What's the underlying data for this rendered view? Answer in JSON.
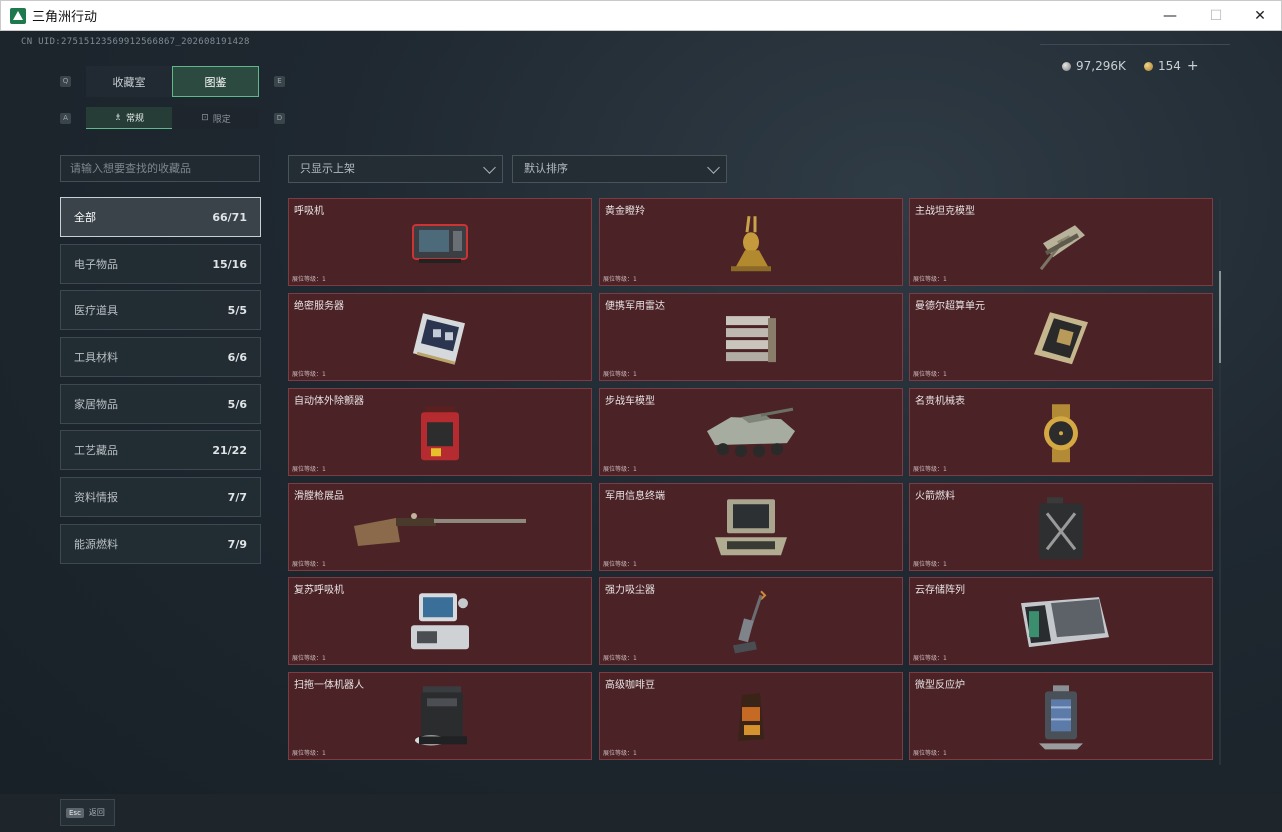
{
  "window": {
    "title": "三角洲行动",
    "min": "—",
    "max": "☐",
    "close": "✕"
  },
  "uid": "CN UID:27515123569912566867_202608191428",
  "currency": {
    "silver": "97,296K",
    "gold": "154",
    "plus": "+"
  },
  "keys": {
    "q": "Q",
    "e": "E",
    "a": "A",
    "d": "D"
  },
  "tabs": [
    {
      "label": "收藏室"
    },
    {
      "label": "图鉴"
    }
  ],
  "subtabs": [
    {
      "label": "常规",
      "icon": "♗"
    },
    {
      "label": "限定",
      "icon": "⊡"
    }
  ],
  "search": {
    "placeholder": "请输入想要查找的收藏品"
  },
  "filters": {
    "shelf": "只显示上架",
    "sort": "默认排序"
  },
  "categories": [
    {
      "label": "全部",
      "count": "66/71"
    },
    {
      "label": "电子物品",
      "count": "15/16"
    },
    {
      "label": "医疗道具",
      "count": "5/5"
    },
    {
      "label": "工具材料",
      "count": "6/6"
    },
    {
      "label": "家居物品",
      "count": "5/6"
    },
    {
      "label": "工艺藏品",
      "count": "21/22"
    },
    {
      "label": "资料情报",
      "count": "7/7"
    },
    {
      "label": "能源燃料",
      "count": "7/9"
    }
  ],
  "items": [
    {
      "name": "呼吸机",
      "level": "展位等级：1",
      "icon": "ventilator-icon"
    },
    {
      "name": "黄金瞪羚",
      "level": "展位等级：1",
      "icon": "golden-gazelle-icon"
    },
    {
      "name": "主战坦克模型",
      "level": "展位等级：1",
      "icon": "tank-model-icon"
    },
    {
      "name": "绝密服务器",
      "level": "展位等级：1",
      "icon": "server-icon"
    },
    {
      "name": "便携军用雷达",
      "level": "展位等级：1",
      "icon": "radar-icon"
    },
    {
      "name": "曼德尔超算单元",
      "level": "展位等级：1",
      "icon": "compute-unit-icon"
    },
    {
      "name": "自动体外除颤器",
      "level": "展位等级：1",
      "icon": "defibrillator-icon"
    },
    {
      "name": "步战车模型",
      "level": "展位等级：1",
      "icon": "ifv-model-icon"
    },
    {
      "name": "名贵机械表",
      "level": "展位等级：1",
      "icon": "watch-icon"
    },
    {
      "name": "滑膛枪展品",
      "level": "展位等级：1",
      "icon": "musket-icon"
    },
    {
      "name": "军用信息终端",
      "level": "展位等级：1",
      "icon": "terminal-icon"
    },
    {
      "name": "火箭燃料",
      "level": "展位等级：1",
      "icon": "fuel-can-icon"
    },
    {
      "name": "复苏呼吸机",
      "level": "展位等级：1",
      "icon": "resus-ventilator-icon"
    },
    {
      "name": "强力吸尘器",
      "level": "展位等级：1",
      "icon": "vacuum-icon"
    },
    {
      "name": "云存储阵列",
      "level": "展位等级：1",
      "icon": "storage-array-icon"
    },
    {
      "name": "扫拖一体机器人",
      "level": "展位等级：1",
      "icon": "robot-vacuum-icon"
    },
    {
      "name": "高级咖啡豆",
      "level": "展位等级：1",
      "icon": "coffee-bag-icon"
    },
    {
      "name": "微型反应炉",
      "level": "展位等级：1",
      "icon": "reactor-icon"
    }
  ],
  "back": {
    "key": "Esc",
    "label": "返回"
  }
}
